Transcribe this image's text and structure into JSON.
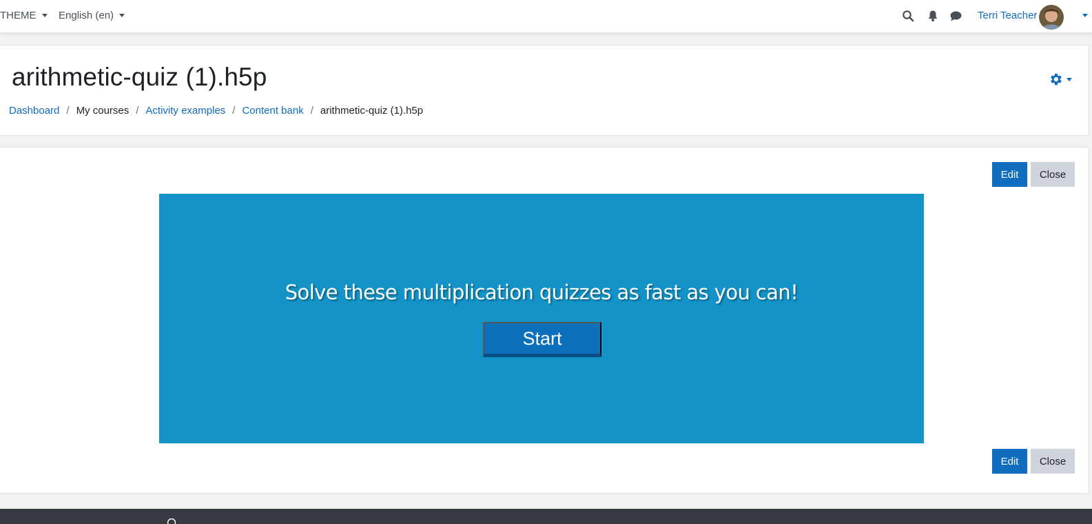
{
  "navbar": {
    "theme_label": "THEME",
    "language_label": "English (en)",
    "user_name": "Terri Teacher",
    "icons": [
      "search-icon",
      "bell-icon",
      "chat-icon",
      "chevron-down-icon"
    ]
  },
  "header": {
    "title": "arithmetic-quiz (1).h5p",
    "breadcrumb": [
      {
        "label": "Dashboard",
        "link": true
      },
      {
        "label": "My courses",
        "link": false
      },
      {
        "label": "Activity examples",
        "link": true
      },
      {
        "label": "Content bank",
        "link": true
      },
      {
        "label": "arithmetic-quiz (1).h5p",
        "link": false
      }
    ],
    "settings_icon": "gear-icon"
  },
  "content": {
    "edit_label": "Edit",
    "close_label": "Close",
    "h5p": {
      "intro_text": "Solve these multiplication quizzes as fast as you can!",
      "start_label": "Start",
      "background": "#1393c7"
    }
  },
  "colors": {
    "accent": "#0f6cbf",
    "footer": "#343a40"
  }
}
